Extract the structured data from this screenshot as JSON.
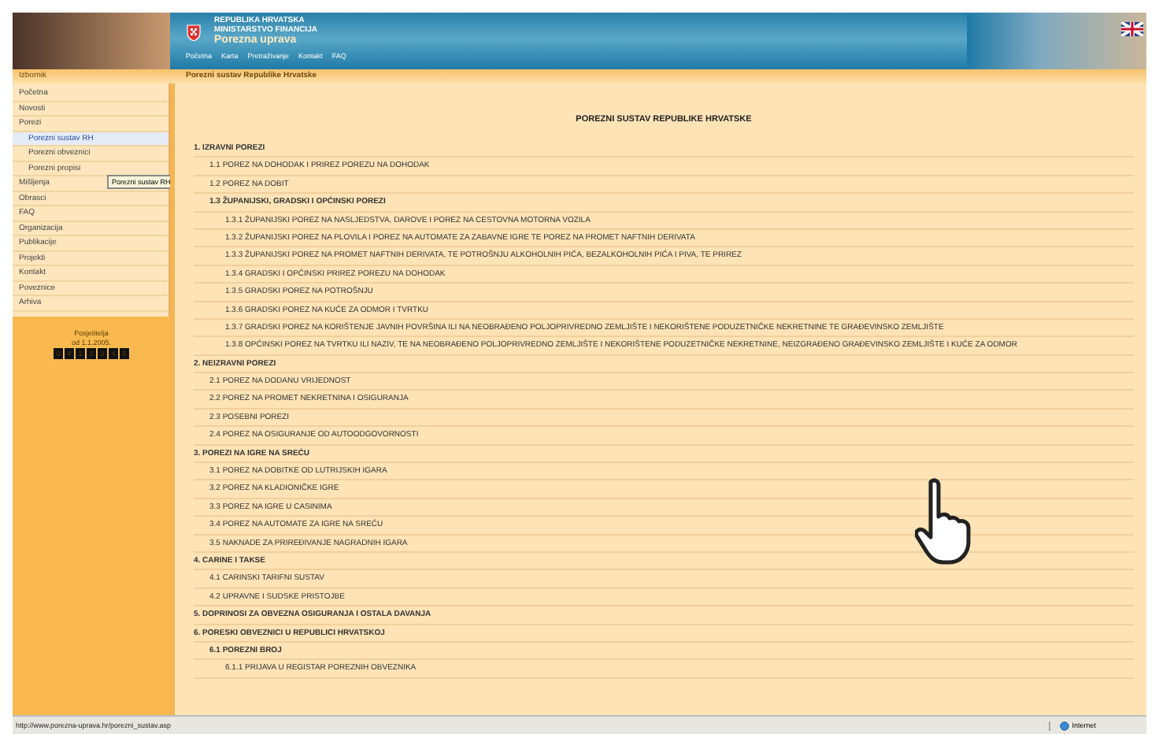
{
  "header": {
    "lines": [
      "REPUBLIKA HRVATSKA",
      "MINISTARSTVO FINANCIJA",
      "Porezna uprava"
    ],
    "nav": [
      "Početna",
      "Karta",
      "Pretraživanje",
      "Kontakt",
      "FAQ"
    ]
  },
  "breadcrumb": {
    "menu_label": "Izbornik",
    "path": "Porezni sustav Republike Hrvatske"
  },
  "sidebar": {
    "items": [
      {
        "label": "Početna",
        "selected": false
      },
      {
        "label": "Novosti",
        "selected": false
      },
      {
        "label": "Porezi",
        "selected": false,
        "children": [
          {
            "label": "Porezni sustav RH",
            "selected": true
          },
          {
            "label": "Porezni obveznici",
            "selected": false
          },
          {
            "label": "Porezni propisi",
            "selected": false
          }
        ]
      },
      {
        "label": "Mišljenja",
        "selected": false
      },
      {
        "label": "Obrasci",
        "selected": false
      },
      {
        "label": "FAQ",
        "selected": false
      },
      {
        "label": "Organizacija",
        "selected": false
      },
      {
        "label": "Publikacije",
        "selected": false
      },
      {
        "label": "Projekti",
        "selected": false
      },
      {
        "label": "Kontakt",
        "selected": false
      },
      {
        "label": "Poveznice",
        "selected": false
      },
      {
        "label": "Arhiva",
        "selected": false
      }
    ],
    "tooltip": "Porezni sustav RH",
    "counter": {
      "label": "Posjetitelja",
      "since": "od 1.1.2005.",
      "digits": [
        "0",
        "4",
        "1",
        "2",
        "3",
        "4",
        "5"
      ]
    }
  },
  "content": {
    "title": "POREZNI SUSTAV REPUBLIKE HRVATSKE",
    "sections": [
      {
        "label": "1. IZRAVNI POREZI",
        "children": [
          {
            "label": "1.1 POREZ NA DOHODAK I PRIREZ POREZU NA DOHODAK"
          },
          {
            "label": "1.2 POREZ NA DOBIT"
          },
          {
            "label": "1.3 ŽUPANIJSKI, GRADSKI I OPĆINSKI POREZI",
            "children": [
              {
                "label": "1.3.1 ŽUPANIJSKI POREZ NA NASLJEDSTVA, DAROVE I POREZ NA CESTOVNA MOTORNA VOZILA"
              },
              {
                "label": "1.3.2 ŽUPANIJSKI POREZ NA PLOVILA I POREZ NA AUTOMATE ZA ZABAVNE IGRE TE POREZ NA PROMET NAFTNIH DERIVATA"
              },
              {
                "label": "1.3.3 ŽUPANIJSKI POREZ NA PROMET NAFTNIH DERIVATA, TE POTROŠNJU ALKOHOLNIH PIĆA, BEZALKOHOLNIH PIĆA I PIVA, TE PRIREZ"
              },
              {
                "label": "1.3.4 GRADSKI I OPĆINSKI PRIREZ POREZU NA DOHODAK"
              },
              {
                "label": "1.3.5 GRADSKI POREZ NA POTROŠNJU"
              },
              {
                "label": "1.3.6 GRADSKI POREZ NA KUĆE ZA ODMOR I TVRTKU"
              },
              {
                "label": "1.3.7 GRADSKI POREZ NA KORIŠTENJE JAVNIH POVRŠINA ILI NA NEOBRAĐENO POLJOPRIVREDNO ZEMLJIŠTE I NEKORIŠTENE PODUZETNIČKE NEKRETNINE TE GRAĐEVINSKO ZEMLJIŠTE"
              },
              {
                "label": "1.3.8 OPĆINSKI POREZ NA TVRTKU ILI NAZIV, TE NA NEOBRAĐENO POLJOPRIVREDNO ZEMLJIŠTE I NEKORIŠTENE PODUZETNIČKE NEKRETNINE, NEIZGRAĐENO GRAĐEVINSKO ZEMLJIŠTE I KUĆE ZA ODMOR"
              }
            ]
          }
        ]
      },
      {
        "label": "2. NEIZRAVNI POREZI",
        "children": [
          {
            "label": "2.1 POREZ NA DODANU VRIJEDNOST"
          },
          {
            "label": "2.2 POREZ NA PROMET NEKRETNINA I OSIGURANJA"
          },
          {
            "label": "2.3 POSEBNI POREZI"
          },
          {
            "label": "2.4 POREZ NA OSIGURANJE OD AUTOODGOVORNOSTI"
          }
        ]
      },
      {
        "label": "3. POREZI NA IGRE NA SREĆU",
        "children": [
          {
            "label": "3.1 POREZ NA DOBITKE OD LUTRIJSKIH IGARA"
          },
          {
            "label": "3.2 POREZ NA KLADIONIČKE IGRE"
          },
          {
            "label": "3.3 POREZ NA IGRE U CASINIMA"
          },
          {
            "label": "3.4 POREZ NA AUTOMATE ZA IGRE NA SREĆU"
          },
          {
            "label": "3.5 NAKNADE ZA PRIREĐIVANJE NAGRADNIH IGARA"
          }
        ]
      },
      {
        "label": "4. CARINE I TAKSE",
        "children": [
          {
            "label": "4.1 CARINSKI TARIFNI SUSTAV"
          },
          {
            "label": "4.2 UPRAVNE I SUDSKE PRISTOJBE"
          }
        ]
      },
      {
        "label": "5. DOPRINOSI ZA OBVEZNA OSIGURANJA I OSTALA DAVANJA"
      },
      {
        "label": "6. PORESKI OBVEZNICI U REPUBLICI HRVATSKOJ",
        "children": [
          {
            "label": "6.1 POREZNI BROJ",
            "children": [
              {
                "label": "6.1.1 PRIJAVA U REGISTAR POREZNIH OBVEZNIKA"
              }
            ]
          }
        ]
      }
    ]
  },
  "status_bar": {
    "url": "http://www.porezna-uprava.hr/porezni_sustav.asp",
    "zone": "Internet"
  }
}
